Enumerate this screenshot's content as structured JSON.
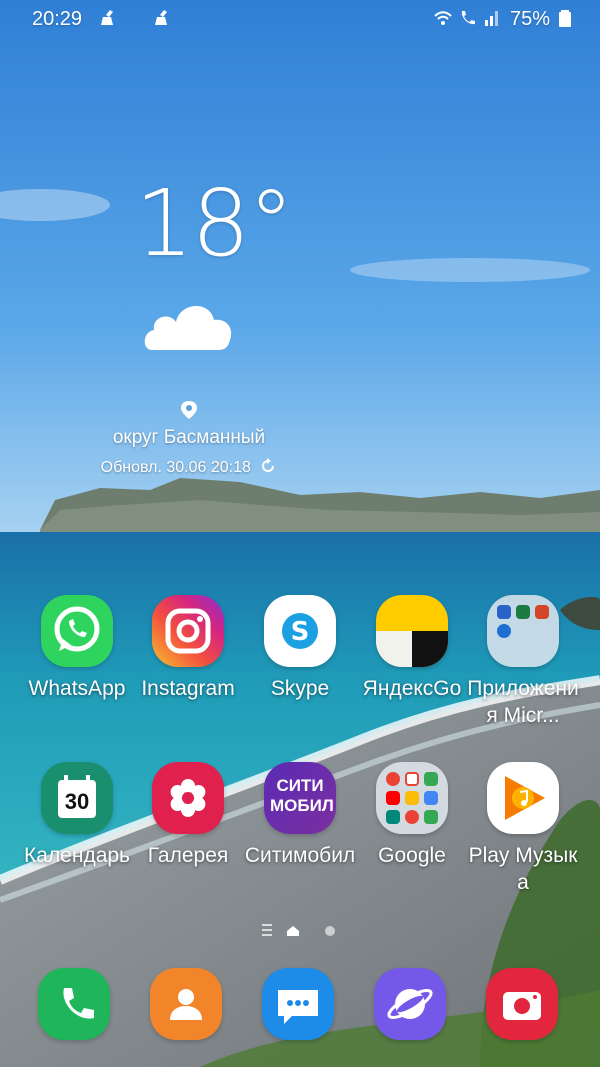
{
  "status_bar": {
    "time": "20:29",
    "battery_percent": "75%",
    "icons": [
      "cleaner-icon",
      "cleaner-icon",
      "wifi-icon",
      "wifi-call-icon",
      "signal-icon",
      "battery-icon"
    ]
  },
  "weather": {
    "temperature": "18°",
    "condition_icon": "cloud-icon",
    "location": "округ Басманный",
    "updated": "Обновл. 30.06 20:18"
  },
  "apps_row1": [
    {
      "label": "WhatsApp",
      "icon": "whatsapp-icon"
    },
    {
      "label": "Instagram",
      "icon": "instagram-icon"
    },
    {
      "label": "Skype",
      "icon": "skype-icon"
    },
    {
      "label": "ЯндексGo",
      "icon": "yandexgo-icon"
    },
    {
      "label": "Приложения Micr...",
      "icon": "microsoft-folder-icon"
    }
  ],
  "apps_row2": [
    {
      "label": "Календарь",
      "icon": "calendar-icon",
      "badge": "30"
    },
    {
      "label": "Галерея",
      "icon": "gallery-icon"
    },
    {
      "label": "Ситимобил",
      "icon": "citymobil-icon",
      "logo_text": "СИТИ МОБИЛ"
    },
    {
      "label": "Google",
      "icon": "google-folder-icon"
    },
    {
      "label": "Play Музыка",
      "icon": "play-music-icon"
    }
  ],
  "page_indicator": {
    "pages": 2,
    "current": 1
  },
  "dock": [
    {
      "icon": "phone-icon"
    },
    {
      "icon": "contacts-icon"
    },
    {
      "icon": "messages-icon"
    },
    {
      "icon": "browser-icon"
    },
    {
      "icon": "camera-icon"
    }
  ],
  "colors": {
    "whatsapp": "#2fd45e",
    "skype": "#1ba0e2",
    "calendar": "#1a8f6e",
    "gallery": "#e0204d",
    "phone": "#1fb55a",
    "contacts": "#f2842a",
    "messages": "#1d8be8",
    "browser": "#7458e8",
    "camera": "#e2263e"
  }
}
